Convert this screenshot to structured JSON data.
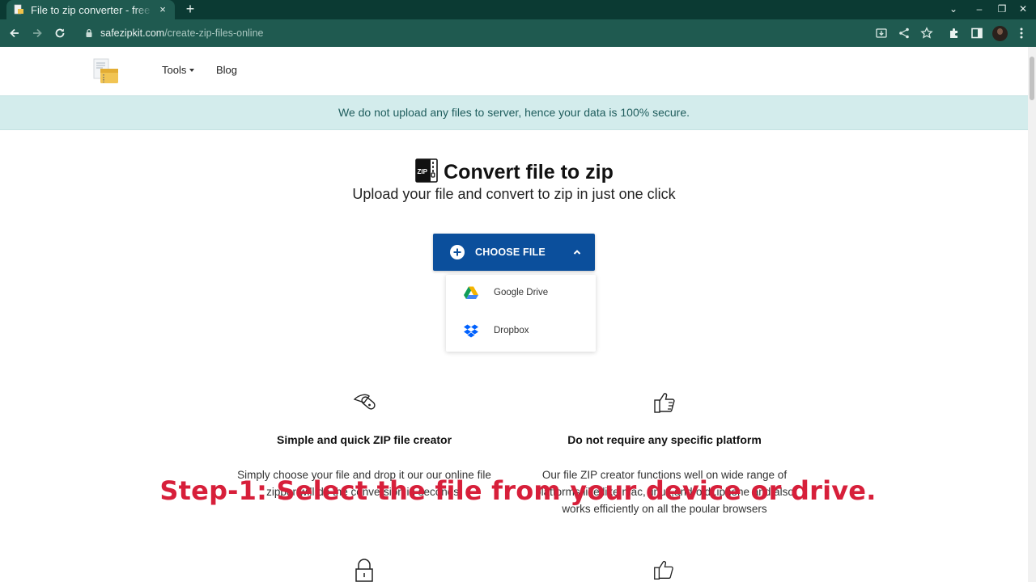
{
  "browser": {
    "tab_title": "File to zip converter - free",
    "tab_close": "×",
    "new_tab": "+",
    "url_host": "safezipkit.com",
    "url_path": "/create-zip-files-online",
    "window_controls": {
      "collapse": "⌄",
      "minimize": "–",
      "restore": "❐",
      "close": "✕"
    }
  },
  "site": {
    "nav": {
      "tools_label": "Tools",
      "blog_label": "Blog"
    },
    "notice": "We do not upload any files to server, hence your data is 100% secure.",
    "hero": {
      "title": "Convert file to zip",
      "subtitle": "Upload your file and convert to zip in just one click"
    },
    "upload": {
      "button_label": "CHOOSE FILE",
      "sources": [
        {
          "label": "Google Drive",
          "icon": "google-drive-icon"
        },
        {
          "label": "Dropbox",
          "icon": "dropbox-icon"
        }
      ]
    },
    "features": [
      {
        "icon": "swiss-knife-icon",
        "title": "Simple and quick ZIP file creator",
        "desc_line1": "Simply choose your file and drop it our our online file",
        "desc_line2": "zipper will do the conversion in seconds."
      },
      {
        "icon": "thumbs-up-icon",
        "title": "Do not require any specific platform",
        "desc_line1": "Our file ZIP creator functions well on wide range of",
        "desc_line2": "platforms like like mac, linux,android ,iphone and also",
        "desc_line3": "works efficiently on all the poular browsers"
      }
    ]
  },
  "overlay_caption": "Step-1: Select the file from your device or drive.",
  "colors": {
    "browser_frame": "#0b3a33",
    "toolbar": "#1f5a50",
    "notice_bg": "#d3ecec",
    "button_primary": "#0b4f9c",
    "caption_red": "#d71f3a"
  }
}
